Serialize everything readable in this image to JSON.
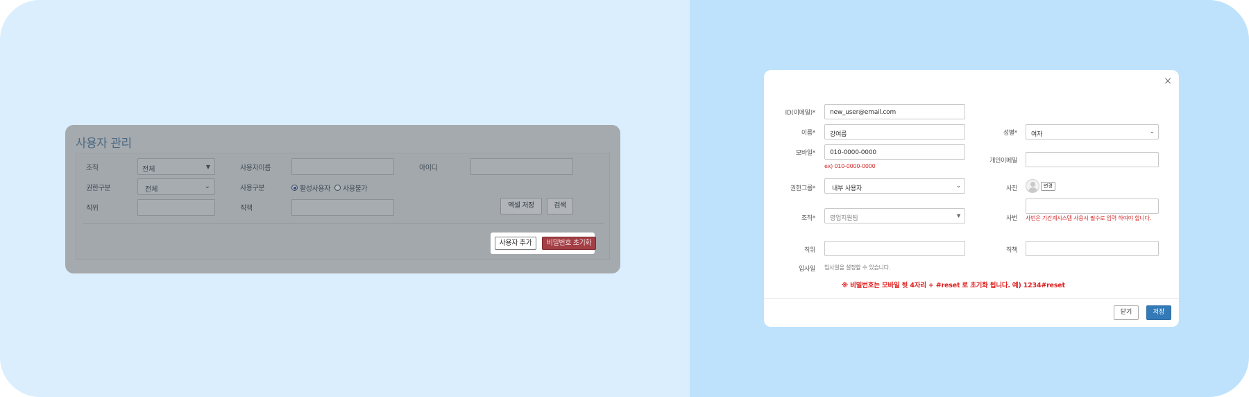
{
  "page": {
    "title": "사용자 관리",
    "filters": {
      "org_label": "조직",
      "org_value": "전체",
      "username_label": "사용자이름",
      "id_label": "아이디",
      "auth_label": "권한구분",
      "auth_value": "전체",
      "usage_label": "사용구분",
      "usage_options": [
        "활성사용자",
        "사용불가"
      ],
      "position_label": "직위",
      "duty_label": "직책"
    },
    "buttons": {
      "excel_save": "엑셀 저장",
      "search": "검색",
      "add_user": "사용자 추가",
      "reset_password": "비밀번호 초기화"
    }
  },
  "modal": {
    "fields": {
      "id_label": "ID(이메일)*",
      "id_value": "new_user@email.com",
      "name_label": "이름*",
      "name_value": "강여름",
      "gender_label": "성별*",
      "gender_value": "여자",
      "mobile_label": "모바일*",
      "mobile_value": "010-0000-0000",
      "mobile_hint": "ex) 010-0000-0000",
      "personal_email_label": "개인이메일",
      "auth_group_label": "권한그룹*",
      "auth_group_value": "내부 사용자",
      "photo_label": "사진",
      "photo_button": "변경",
      "org_label": "조직*",
      "org_value": "영업지원팀",
      "emp_no_label": "사번",
      "emp_no_hint": "사번은 기간계시스템 사용시 필수로 입력 하여야 합니다.",
      "position_label": "직위",
      "duty_label": "직책",
      "join_date_label": "입사일",
      "join_date_hint": "입사일을 설정할 수 있습니다."
    },
    "notice": "※ 비밀번호는 모바일 뒷 4자리 + #reset 로 초기화 됩니다. 예) 1234#reset",
    "buttons": {
      "close": "닫기",
      "save": "저장"
    },
    "close_icon": "×"
  },
  "colors": {
    "left_bg": "#dbeefe",
    "right_bg": "#bee2fc",
    "reset_button": "#a33f45",
    "save_button": "#337ab7",
    "hint_red": "#d42a2a"
  }
}
